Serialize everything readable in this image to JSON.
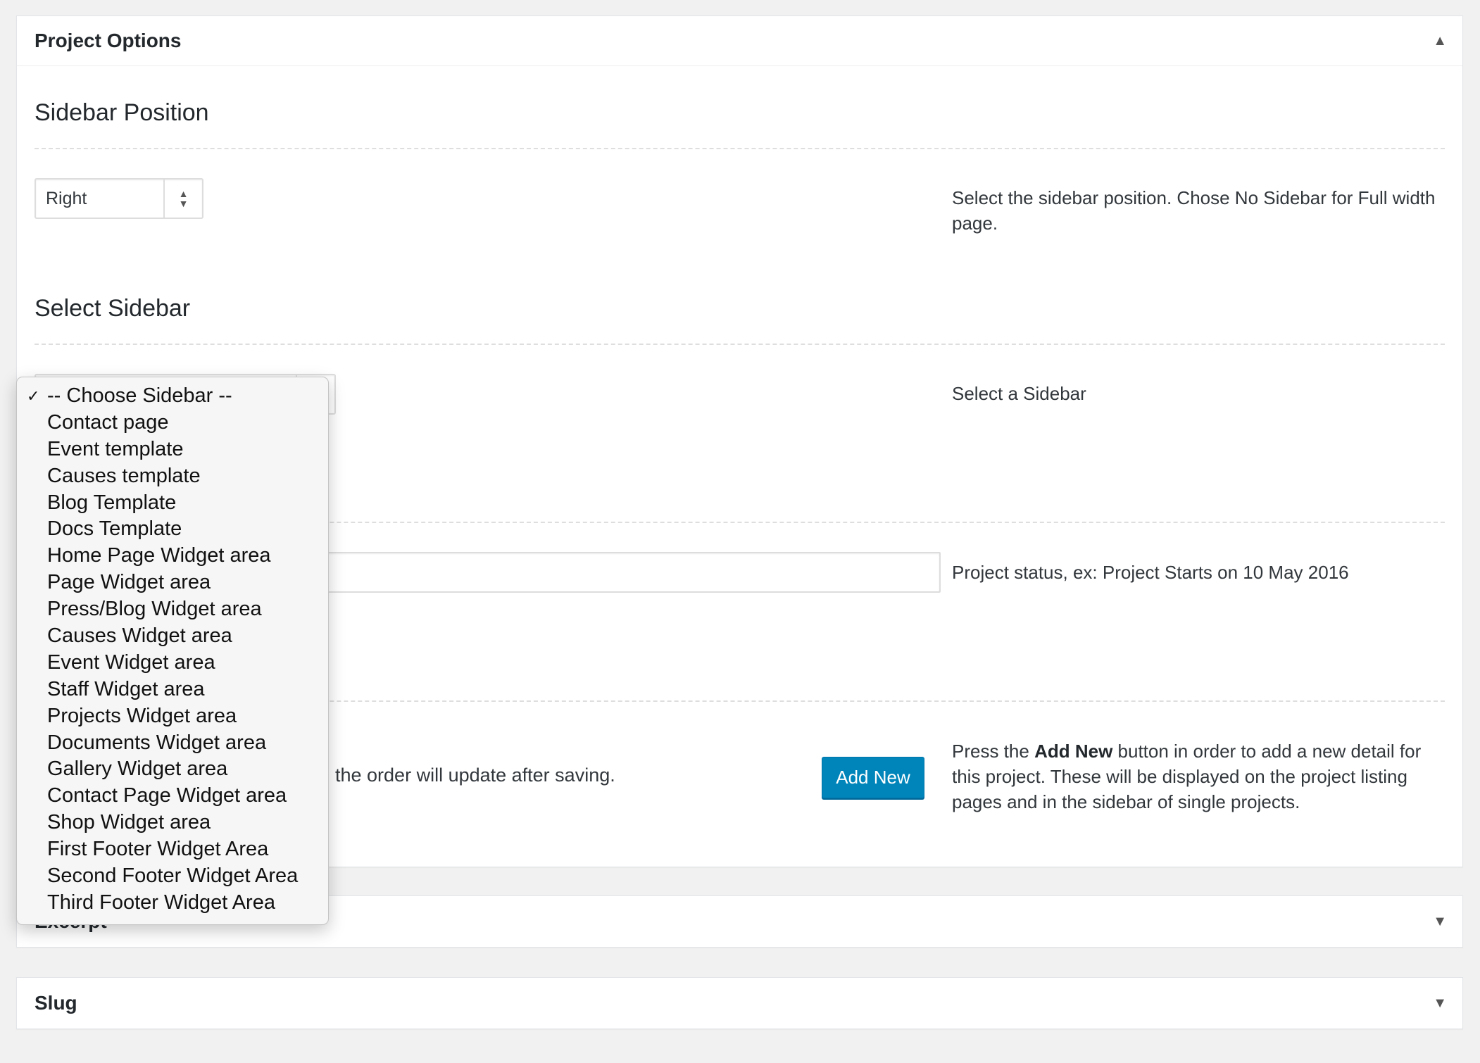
{
  "project_options": {
    "title": "Project Options",
    "sidebar_position": {
      "heading": "Sidebar Position",
      "selected": "Right",
      "description": "Select the sidebar position. Chose No Sidebar for Full width page."
    },
    "select_sidebar": {
      "heading": "Select Sidebar",
      "description": "Select a Sidebar",
      "dropdown_options": [
        "-- Choose Sidebar --",
        "Contact page",
        "Event template",
        "Causes template",
        "Blog Template",
        "Docs Template",
        "Home Page Widget area",
        "Page Widget area",
        "Press/Blog Widget area",
        "Causes Widget area",
        "Event Widget area",
        "Staff Widget area",
        "Projects Widget area",
        "Documents Widget area",
        "Gallery Widget area",
        "Contact Page Widget area",
        "Shop Widget area",
        "First Footer Widget Area",
        "Second Footer Widget Area",
        "Third Footer Widget Area"
      ],
      "checked_option": "-- Choose Sidebar --"
    },
    "project_status": {
      "value": "",
      "description": "Project status, ex: Project Starts on 10 May 2016"
    },
    "details": {
      "order_note": "the order will update after saving.",
      "add_new_label": "Add New",
      "description_pre": "Press the ",
      "description_bold": "Add New",
      "description_post": " button in order to add a new detail for this project. These will be displayed on the project listing pages and in the sidebar of single projects."
    }
  },
  "excerpt": {
    "title": "Excerpt"
  },
  "slug": {
    "title": "Slug"
  },
  "icons": {
    "collapse": "triangle-up-icon",
    "expand": "triangle-down-icon",
    "select": "updown-arrows-icon",
    "check": "checkmark-icon"
  }
}
